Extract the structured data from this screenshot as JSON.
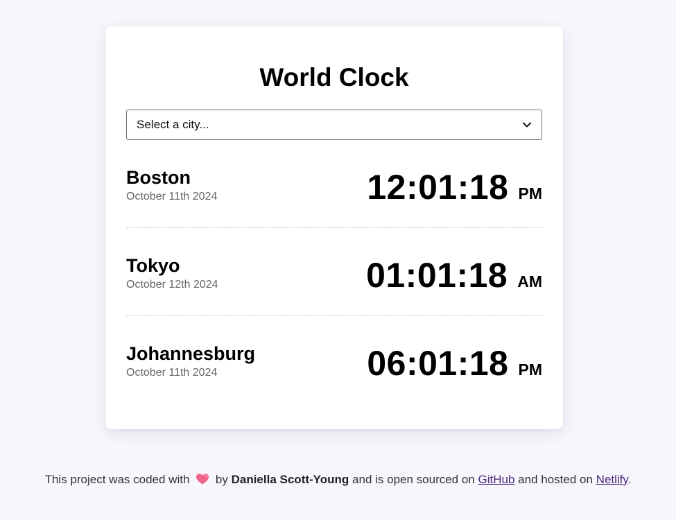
{
  "title": "World Clock",
  "select": {
    "selected_label": "Select a city..."
  },
  "cities": [
    {
      "name": "Boston",
      "date": "October 11th 2024",
      "time": "12:01:18",
      "ampm": "PM"
    },
    {
      "name": "Tokyo",
      "date": "October 12th 2024",
      "time": "01:01:18",
      "ampm": "AM"
    },
    {
      "name": "Johannesburg",
      "date": "October 11th 2024",
      "time": "06:01:18",
      "ampm": "PM"
    }
  ],
  "footer": {
    "text_1": "This project was coded with",
    "text_2": "by",
    "author": "Daniella Scott-Young",
    "text_3": "and is open sourced on",
    "github_label": "GitHub",
    "text_4": "and hosted on",
    "netlify_label": "Netlify",
    "text_5": ".",
    "heart_icon": "heart-icon"
  },
  "colors": {
    "page_bg": "#f7f6fc",
    "card_bg": "#ffffff",
    "link": "#4b2a7a",
    "heart": "#f06488"
  }
}
